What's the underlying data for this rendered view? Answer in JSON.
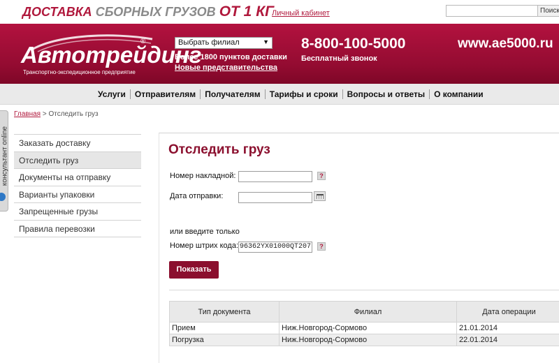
{
  "promo": {
    "part1": "ДОСТАВКА",
    "part2": "СБОРНЫХ ГРУЗОВ",
    "part3": "ОТ 1 КГ"
  },
  "top": {
    "cabinet": "Личный кабинет",
    "search_button": "Поиск"
  },
  "header": {
    "logo": "Автотрейдинг",
    "logo_reg": "®",
    "tagline": "Транспортно-экспедиционное предприятие",
    "branch_select": "Выбрать филиал",
    "points": "Более 1800 пунктов доставки",
    "new_offices": "Новые представительства",
    "phone": "8-800-100-5000",
    "phone_note": "Бесплатный звонок",
    "site": "www.ae5000.ru"
  },
  "nav": [
    {
      "label": "Услуги"
    },
    {
      "label": "Отправителям"
    },
    {
      "label": "Получателям"
    },
    {
      "label": "Тарифы и сроки"
    },
    {
      "label": "Вопросы и ответы"
    },
    {
      "label": "О компании"
    }
  ],
  "consultant": {
    "label": "консультант online"
  },
  "breadcrumb": {
    "home": "Главная",
    "sep": ">",
    "current": "Отследить груз"
  },
  "sidebar": [
    {
      "label": "Заказать доставку"
    },
    {
      "label": "Отследить груз"
    },
    {
      "label": "Документы на отправку"
    },
    {
      "label": "Варианты упаковки"
    },
    {
      "label": "Запрещенные грузы"
    },
    {
      "label": "Правила перевозки"
    }
  ],
  "form": {
    "title": "Отследить груз",
    "invoice_label": "Номер накладной:",
    "invoice_value": "",
    "date_label": "Дата отправки:",
    "date_value": "",
    "or_text": "или введите только",
    "barcode_label": "Номер штрих кода:",
    "barcode_value": "96362YX01000QT207",
    "help": "?",
    "submit": "Показать"
  },
  "results": {
    "headers": [
      "Тип документа",
      "Филиал",
      "Дата операции"
    ],
    "rows": [
      [
        "Прием",
        "Ниж.Новгород-Сормово",
        "21.01.2014"
      ],
      [
        "Погрузка",
        "Ниж.Новгород-Сормово",
        "22.01.2014"
      ]
    ]
  },
  "colors": {
    "brand": "#b0183c",
    "header_bg": "#930b31",
    "nav_bg": "#eaeaea"
  }
}
